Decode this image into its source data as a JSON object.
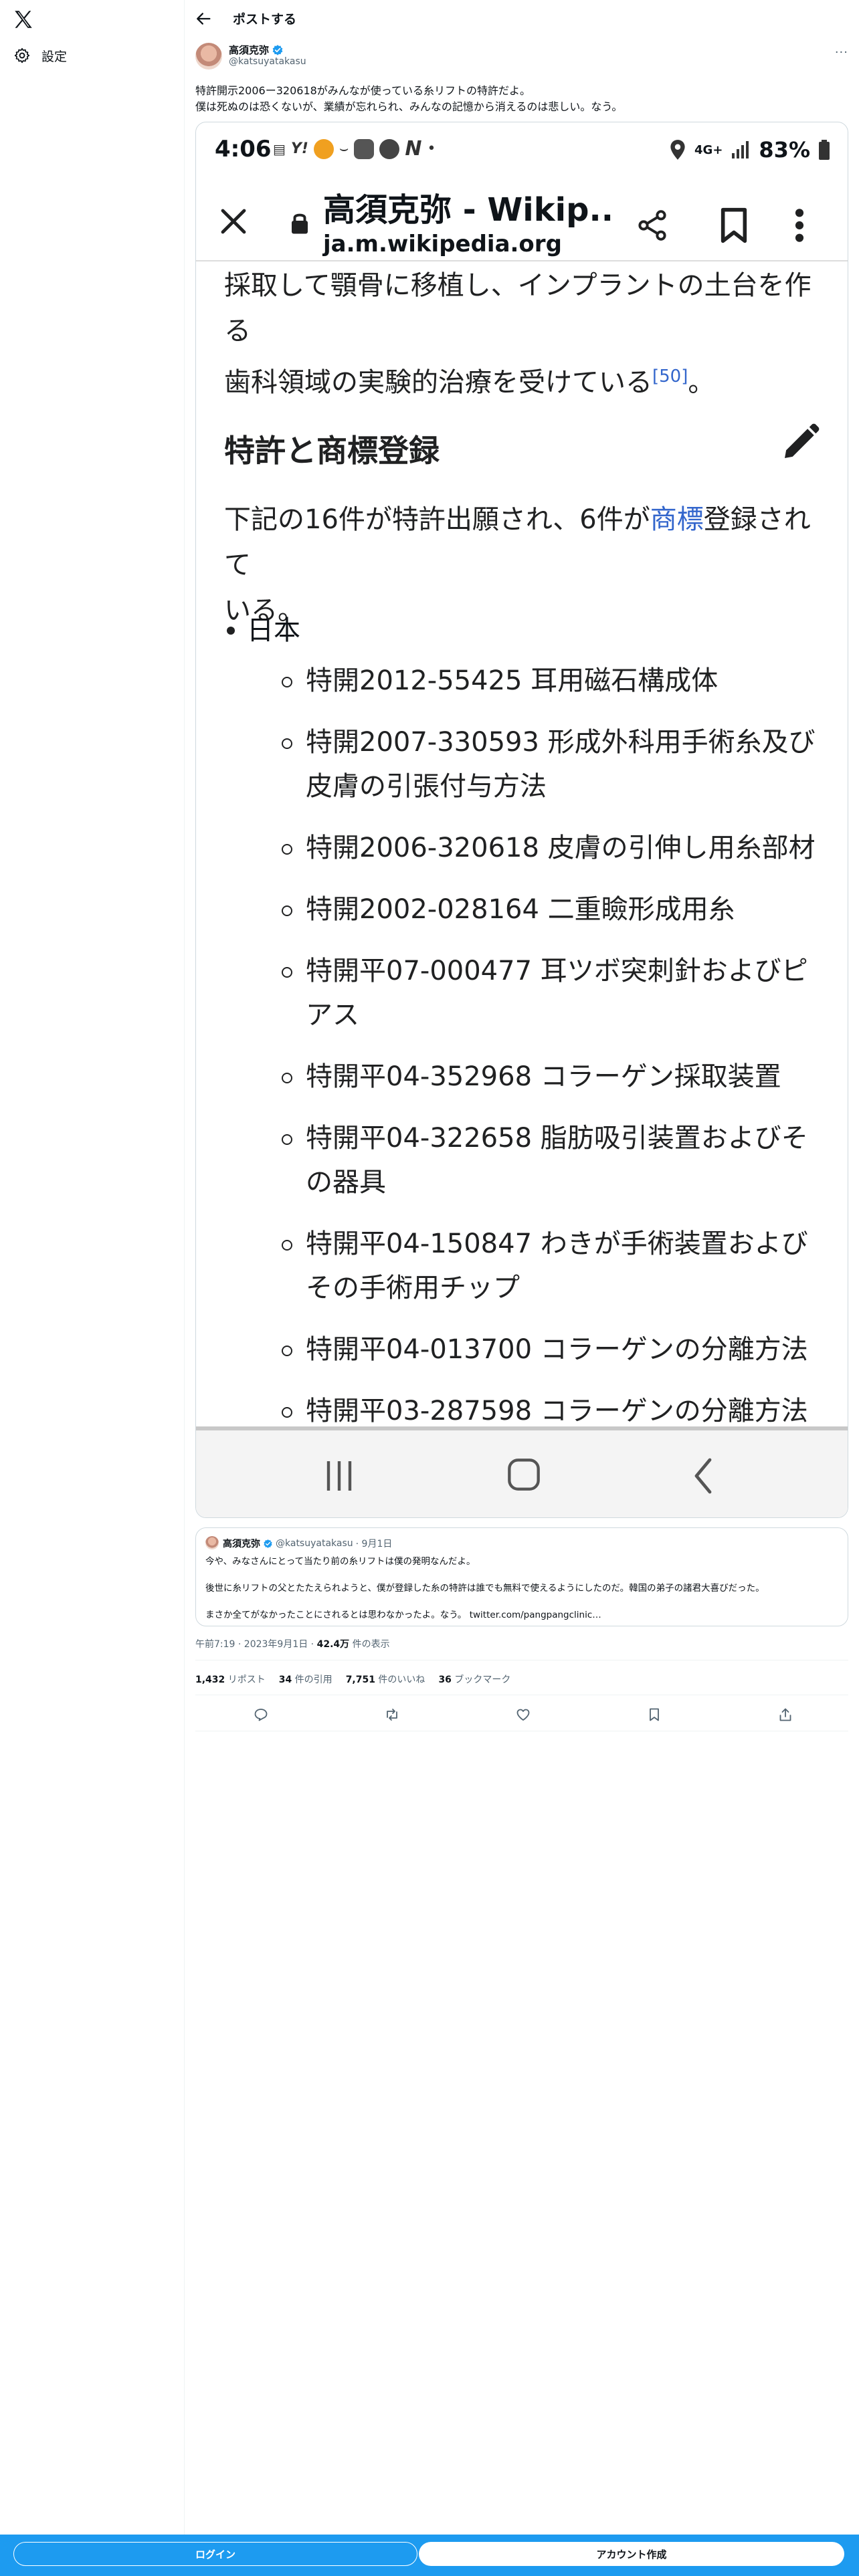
{
  "sidebar": {
    "logo": "x-logo-icon",
    "settings_label": "設定",
    "settings_icon": "gear-icon"
  },
  "header": {
    "title": "ポストする",
    "back_icon": "arrow-left-icon"
  },
  "post": {
    "author_name": "高須克弥",
    "author_handle": "@katsuyatakasu",
    "text_line1": "特許開示2006ー320618がみんなが使っている糸リフトの特許だよ。",
    "text_line2": "僕は死ぬのは恐くないが、業績が忘れられ、みんなの記憶から消えるのは悲しい。なう。"
  },
  "screenshot": {
    "status": {
      "time": "4:06",
      "app_icons": [
        "yahoo-icon",
        "bear-icon",
        "line-icon",
        "nikkei-icon"
      ],
      "network": "4G+",
      "battery": "83%"
    },
    "browser": {
      "title": "高須克弥 - Wikip...",
      "url": "ja.m.wikipedia.org"
    },
    "wiki": {
      "intro_line1": "採取して顎骨に移植し、インプラントの土台を作る",
      "intro_line2": "歯科領域の実験的治療を受けている",
      "intro_ref": "[50]",
      "intro_end": "。",
      "section_heading": "特許と商標登録",
      "para_prefix": "下記の16件が特許出願され、6件が",
      "para_link": "商標",
      "para_suffix": "登録されて",
      "para_line2": "いる。",
      "country": "日本",
      "patents": [
        "特開2012-55425 耳用磁石構成体",
        "特開2007-330593 形成外科用手術糸及び皮膚の引張付与方法",
        "特開2006-320618 皮膚の引伸し用糸部材",
        "特開2002-028164 二重瞼形成用糸",
        "特開平07-000477 耳ツボ突刺針およびピアス",
        "特開平04-352968 コラーゲン採取装置",
        "特開平04-322658 脂肪吸引装置およびその器具",
        "特開平04-150847 わきが手術装置およびその手術用チップ",
        "特開平04-013700 コラーゲンの分離方法",
        "特開平03-287598 コラーゲンの分離方法"
      ]
    }
  },
  "quote": {
    "author_name": "高須克弥",
    "author_handle": "@katsuyatakasu",
    "date": "· 9月1日",
    "line1": "今や、みなさんにとって当たり前の糸リフトは僕の発明なんだよ。",
    "line2": "後世に糸リフトの父とたたえられようと、僕が登録した糸の特許は誰でも無料で使えるようにしたのだ。韓国の弟子の諸君大喜びだった。",
    "line3": "まさか全てがなかったことにされるとは思わなかったよ。なう。 twitter.com/pangpangclinic…"
  },
  "meta": {
    "time": "午前7:19 · 2023年9月1日 · ",
    "views_count": "42.4万",
    "views_label": " 件の表示"
  },
  "stats": {
    "reposts_count": "1,432",
    "reposts_label": " リポスト",
    "quotes_count": "34",
    "quotes_label": " 件の引用",
    "likes_count": "7,751",
    "likes_label": " 件のいいね",
    "bookmarks_count": "36",
    "bookmarks_label": " ブックマーク"
  },
  "actions": [
    "reply-icon",
    "repost-icon",
    "like-icon",
    "bookmark-icon",
    "share-icon"
  ],
  "footer": {
    "login_label": "ログイン",
    "signup_label": "アカウント作成"
  },
  "colors": {
    "accent": "#1d9bf0",
    "link": "#3366cc",
    "secondary_text": "#536471"
  }
}
